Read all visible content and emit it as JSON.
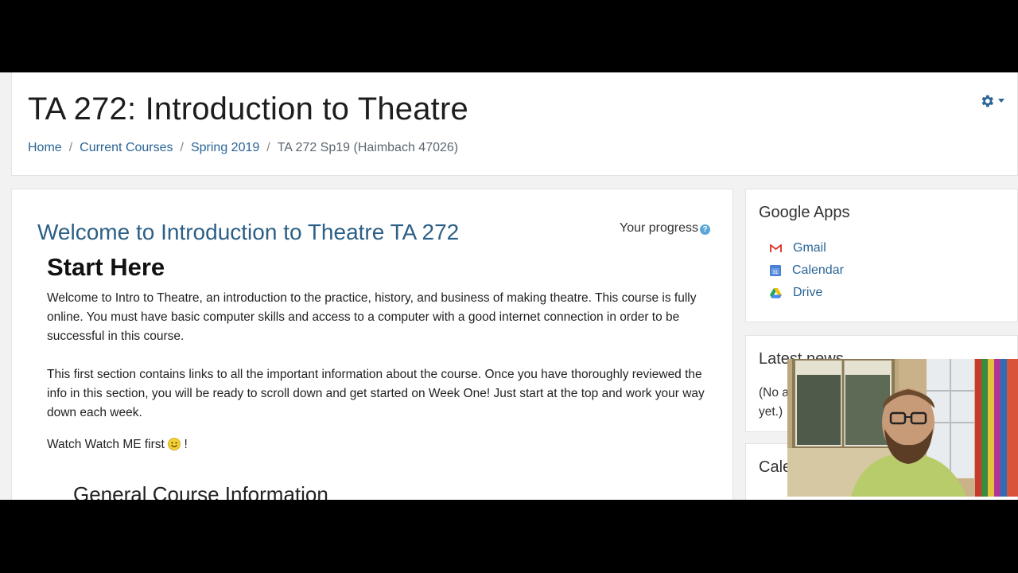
{
  "course": {
    "title": "TA 272: Introduction to Theatre",
    "breadcrumb": [
      "Home",
      "Current Courses",
      "Spring 2019",
      "TA 272 Sp19 (Haimbach 47026)"
    ],
    "settings_icon": "gear-icon"
  },
  "main": {
    "welcome_heading": "Welcome to Introduction to Theatre TA 272",
    "progress_label": "Your progress",
    "progress_help_icon": "help-icon",
    "start_heading": "Start Here",
    "paragraph1": "Welcome to Intro to Theatre, an introduction to the practice, history, and business of making theatre. This course is fully online. You must have basic computer skills and access to a computer with a good internet connection in order to be successful in this course.",
    "paragraph2": "This first section contains links to all the important information about the course. Once you have thoroughly reviewed the info in this section, you will be ready to  scroll down and get started on Week One! Just start at the top and work your way down each week.",
    "watch_text": "Watch Watch ME first",
    "watch_suffix": " !",
    "section_heading": "General Course Information"
  },
  "sidebar": {
    "google_apps": {
      "title": "Google Apps",
      "items": [
        {
          "label": "Gmail",
          "icon": "gmail-icon"
        },
        {
          "label": "Calendar",
          "icon": "calendar-icon"
        },
        {
          "label": "Drive",
          "icon": "drive-icon"
        }
      ]
    },
    "latest_news": {
      "title": "Latest news",
      "text": "(No announcements have been posted yet.)"
    },
    "calendar": {
      "title": "Calendar"
    }
  },
  "colors": {
    "link": "#2a6496",
    "heading_blue": "#2b5f86",
    "help_blue": "#5aa7d8"
  }
}
